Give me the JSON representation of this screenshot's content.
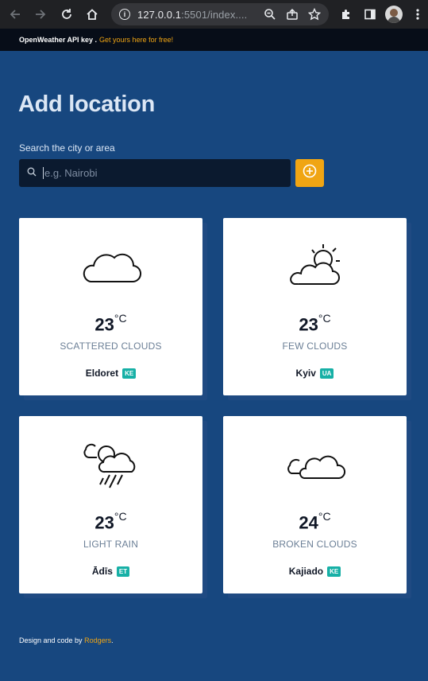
{
  "browser": {
    "url_host": "127.0.0.1",
    "url_rest": ":5501/index...."
  },
  "banner": {
    "text": "OpenWeather API key .",
    "link": "Get yours here for free!"
  },
  "page": {
    "title": "Add location",
    "search_label": "Search the city or area",
    "search_placeholder": "e.g. Nairobi",
    "search_value": ""
  },
  "cards": [
    {
      "temp": "23",
      "unit": "°C",
      "desc": "SCATTERED CLOUDS",
      "city": "Eldoret",
      "code": "KE",
      "icon": "cloud-icon"
    },
    {
      "temp": "23",
      "unit": "°C",
      "desc": "FEW CLOUDS",
      "city": "Kyiv",
      "code": "UA",
      "icon": "partly-sunny-icon"
    },
    {
      "temp": "23",
      "unit": "°C",
      "desc": "LIGHT RAIN",
      "city": "Ādīs",
      "code": "ET",
      "icon": "sun-rain-icon"
    },
    {
      "temp": "24",
      "unit": "°C",
      "desc": "BROKEN CLOUDS",
      "city": "Kajiado",
      "code": "KE",
      "icon": "broken-clouds-icon"
    }
  ],
  "footer": {
    "text": "Design and code by",
    "author": "Rodgers",
    "period": "."
  },
  "colors": {
    "background": "#17477f",
    "accent": "#f0a513",
    "badge": "#17b0a6"
  }
}
